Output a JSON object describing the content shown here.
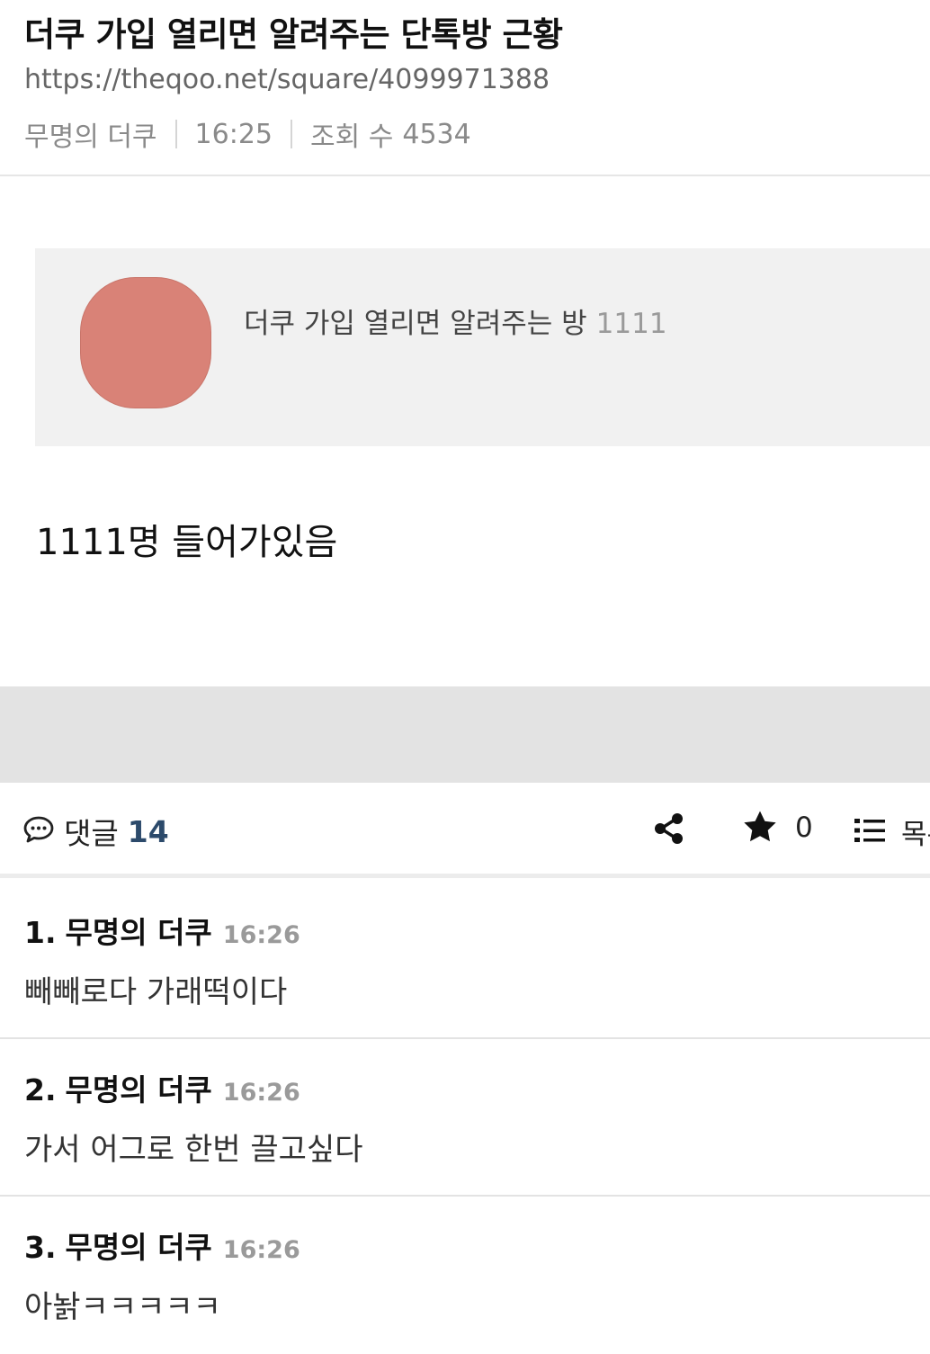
{
  "post": {
    "title": "더쿠 가입 열리면 알려주는 단톡방 근황",
    "url": "https://theqoo.net/square/4099971388",
    "author": "무명의 더쿠",
    "time": "16:25",
    "views_label": "조회 수",
    "views": "4534",
    "body": "1111명 들어가있음"
  },
  "link_card": {
    "title": "더쿠 가입 열리면 알려주는 방",
    "count": "1111",
    "thumbnail_color": "#d98277"
  },
  "action_bar": {
    "comments_label": "댓글",
    "comments_count": "14",
    "star_count": "0",
    "list_label": "목록",
    "icons": [
      "comment-icon",
      "share-icon",
      "star-icon",
      "list-icon"
    ]
  },
  "comments": [
    {
      "num": "1.",
      "author": "무명의 더쿠",
      "time": "16:26",
      "body": "빼빼로다 가래떡이다"
    },
    {
      "num": "2.",
      "author": "무명의 더쿠",
      "time": "16:26",
      "body": "가서 어그로 한번 끌고싶다"
    },
    {
      "num": "3.",
      "author": "무명의 더쿠",
      "time": "16:26",
      "body": "아놝ㅋㅋㅋㅋㅋ"
    }
  ],
  "colors": {
    "comment_count": "#2c4a6b",
    "meta_gray": "#8a8a8a",
    "card_bg": "#f1f1f1",
    "band_gray": "#e3e3e3"
  }
}
